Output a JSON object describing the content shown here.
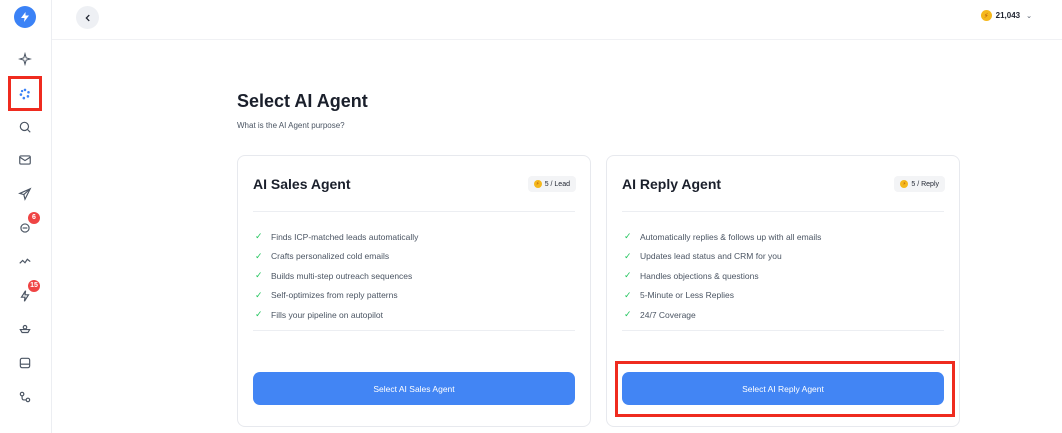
{
  "sidebar": {
    "logo_icon": "bolt-icon",
    "items": [
      {
        "name": "sparkle-icon"
      },
      {
        "name": "ai-agents-icon",
        "active": true
      },
      {
        "name": "search-icon"
      },
      {
        "name": "mail-icon"
      },
      {
        "name": "send-icon"
      },
      {
        "name": "inbox-stack-icon",
        "badge": "6"
      },
      {
        "name": "analytics-icon"
      },
      {
        "name": "zap-icon",
        "badge": "15"
      },
      {
        "name": "integrations-icon"
      },
      {
        "name": "tray-icon"
      },
      {
        "name": "workflow-icon"
      }
    ]
  },
  "topbar": {
    "back_icon": "chevron-left-icon",
    "credits": "21,043"
  },
  "main": {
    "title": "Select AI Agent",
    "subtitle": "What is the AI Agent purpose?"
  },
  "cards": [
    {
      "title": "AI Sales Agent",
      "price": "5 / Lead",
      "features": [
        "Finds ICP-matched leads automatically",
        "Crafts personalized cold emails",
        "Builds multi-step outreach sequences",
        "Self-optimizes from reply patterns",
        "Fills your pipeline on autopilot"
      ],
      "button": "Select AI Sales Agent"
    },
    {
      "title": "AI Reply Agent",
      "price": "5 / Reply",
      "features": [
        "Automatically replies & follows up with all emails",
        "Updates lead status and CRM for you",
        "Handles objections & questions",
        "5-Minute or Less Replies",
        "24/7 Coverage"
      ],
      "button": "Select AI Reply Agent"
    }
  ],
  "colors": {
    "accent": "#4285f4",
    "highlight": "#ef2b1f",
    "check": "#22c55e",
    "badge": "#ef4444",
    "coin": "#f5b81c"
  }
}
